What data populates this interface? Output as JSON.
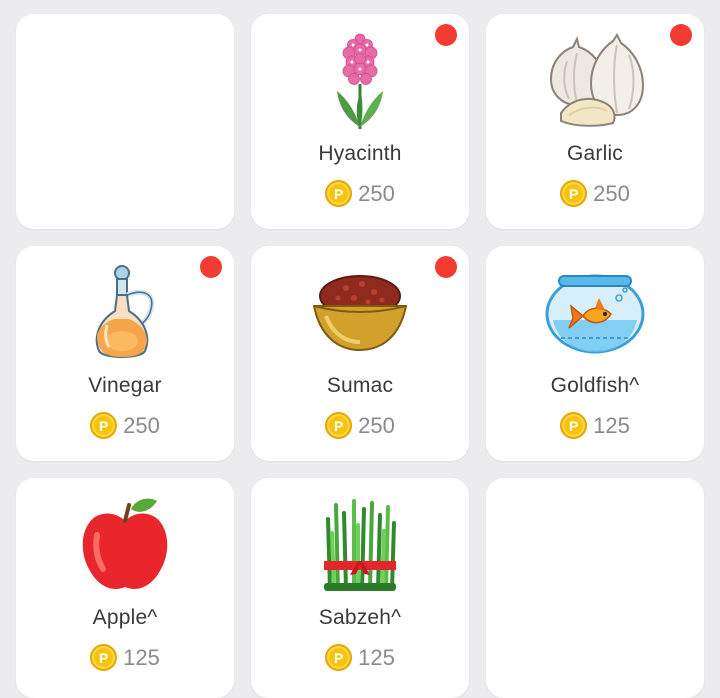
{
  "items": [
    {
      "name": "",
      "price": "",
      "icon": "",
      "has_badge": false
    },
    {
      "name": "Hyacinth",
      "price": "250",
      "icon": "hyacinth-icon",
      "has_badge": true
    },
    {
      "name": "Garlic",
      "price": "250",
      "icon": "garlic-icon",
      "has_badge": true
    },
    {
      "name": "Vinegar",
      "price": "250",
      "icon": "vinegar-icon",
      "has_badge": true
    },
    {
      "name": "Sumac",
      "price": "250",
      "icon": "sumac-icon",
      "has_badge": true
    },
    {
      "name": "Goldfish^",
      "price": "125",
      "icon": "goldfish-icon",
      "has_badge": false
    },
    {
      "name": "Apple^",
      "price": "125",
      "icon": "apple-icon",
      "has_badge": false
    },
    {
      "name": "Sabzeh^",
      "price": "125",
      "icon": "sabzeh-icon",
      "has_badge": false
    },
    {
      "name": "",
      "price": "",
      "icon": "",
      "has_badge": false
    }
  ],
  "coin_symbol": "P",
  "colors": {
    "badge": "#f23c32",
    "coin": "#f6c40f",
    "card": "#ffffff",
    "background": "#ececee"
  }
}
